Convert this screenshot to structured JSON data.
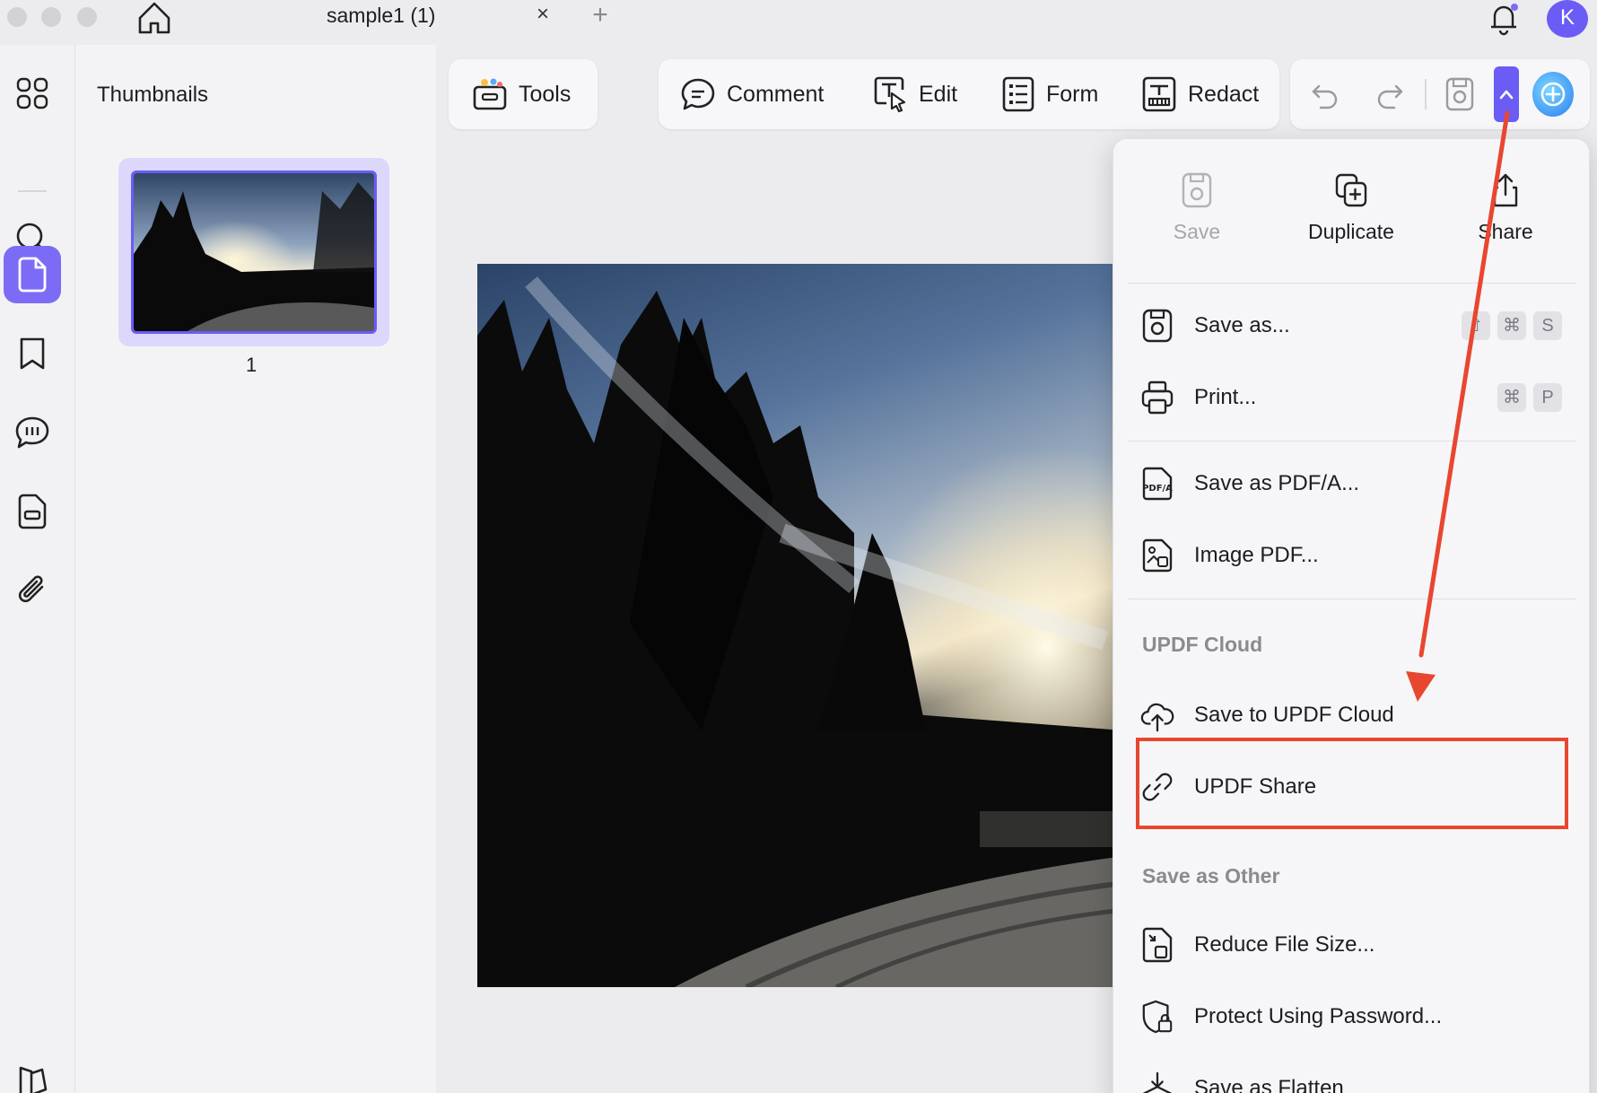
{
  "window": {
    "tab_title": "sample1 (1)",
    "tab_close": "×",
    "tab_add": "+",
    "avatar_initial": "K"
  },
  "sidebar": {
    "panel_title": "Thumbnails",
    "page_number": "1",
    "items": [
      {
        "icon": "grid-icon"
      },
      {
        "icon": "search-icon"
      },
      {
        "icon": "page-icon",
        "active": true
      },
      {
        "icon": "bookmark-icon"
      },
      {
        "icon": "comment-list-icon"
      },
      {
        "icon": "document-icon"
      },
      {
        "icon": "attachment-icon"
      },
      {
        "icon": "layers-icon"
      }
    ]
  },
  "toolbar": {
    "tools_label": "Tools",
    "comment_label": "Comment",
    "edit_label": "Edit",
    "form_label": "Form",
    "redact_label": "Redact"
  },
  "menu": {
    "top_actions": [
      {
        "label": "Save",
        "disabled": true
      },
      {
        "label": "Duplicate",
        "disabled": false
      },
      {
        "label": "Share",
        "disabled": false
      }
    ],
    "items": {
      "save_as": "Save as...",
      "print": "Print...",
      "save_pdfa": "Save as PDF/A...",
      "image_pdf": "Image PDF...",
      "save_cloud": "Save to UPDF Cloud",
      "updf_share": "UPDF Share",
      "reduce_size": "Reduce File Size...",
      "protect": "Protect Using Password...",
      "flatten": "Save as Flatten"
    },
    "sections": {
      "cloud": "UPDF Cloud",
      "other": "Save as Other"
    },
    "shortcuts": {
      "save_as": [
        "⇧",
        "⌘",
        "S"
      ],
      "print": [
        "⌘",
        "P"
      ]
    },
    "pdfa_icon_text": "PDF/A"
  },
  "colors": {
    "accent": "#6a5cf5",
    "annotation": "#e8472f"
  }
}
